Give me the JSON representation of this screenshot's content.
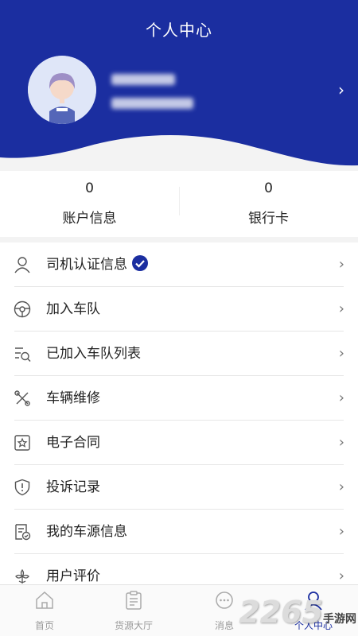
{
  "colors": {
    "brand": "#1b2ea0",
    "tab_active": "#1b2ea0",
    "tab_inactive": "#999999"
  },
  "header": {
    "title": "个人中心"
  },
  "stats": [
    {
      "value": "0",
      "label": "账户信息"
    },
    {
      "value": "0",
      "label": "银行卡"
    }
  ],
  "menu": [
    {
      "label": "司机认证信息",
      "icon": "user-icon",
      "verified": true
    },
    {
      "label": "加入车队",
      "icon": "steering-wheel-icon"
    },
    {
      "label": "已加入车队列表",
      "icon": "list-search-icon"
    },
    {
      "label": "车辆维修",
      "icon": "wrench-icon"
    },
    {
      "label": "电子合同",
      "icon": "contract-star-icon"
    },
    {
      "label": "投诉记录",
      "icon": "shield-alert-icon"
    },
    {
      "label": "我的车源信息",
      "icon": "document-check-icon"
    },
    {
      "label": "用户评价",
      "icon": "flower-icon"
    }
  ],
  "tabs": [
    {
      "label": "首页",
      "icon": "home-icon",
      "active": false
    },
    {
      "label": "货源大厅",
      "icon": "clipboard-icon",
      "active": false
    },
    {
      "label": "消息",
      "icon": "chat-icon",
      "active": false
    },
    {
      "label": "个人中心",
      "icon": "person-icon",
      "active": true
    }
  ],
  "watermark": {
    "big": "2265",
    "small": "手游网"
  }
}
